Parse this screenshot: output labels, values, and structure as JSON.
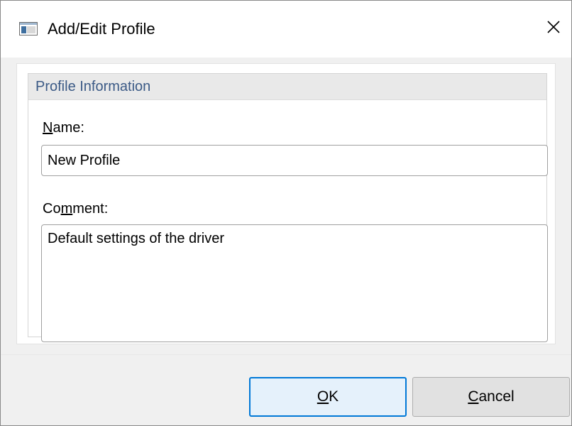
{
  "window": {
    "title": "Add/Edit Profile",
    "icons": {
      "app": "window-app-icon",
      "close": "close-icon"
    }
  },
  "group": {
    "title": "Profile Information"
  },
  "name_field": {
    "label_mnemonic": "N",
    "label_rest": "ame:",
    "value": "New Profile"
  },
  "comment_field": {
    "label_pre": "Co",
    "label_mnemonic": "m",
    "label_post": "ment:",
    "value": "Default settings of the driver"
  },
  "buttons": {
    "ok_mnemonic": "O",
    "ok_rest": "K",
    "cancel_mnemonic": "C",
    "cancel_rest": "ancel"
  },
  "colors": {
    "accent": "#0078d7",
    "group_title": "#3b5a86",
    "dialog_bg": "#f0f0f0"
  }
}
